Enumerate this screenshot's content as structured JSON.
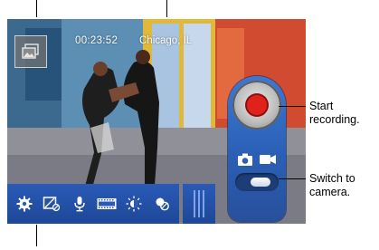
{
  "overlay": {
    "timer": "00:23:52",
    "location": "Chicago, IL"
  },
  "icons": {
    "thumbnail": "gallery-thumbnail-icon",
    "record": "record-icon",
    "camera": "camera-icon",
    "video": "video-camera-icon",
    "toolbar": [
      "settings-gear-icon",
      "flash-off-icon",
      "microphone-icon",
      "film-strip-icon",
      "brightness-icon",
      "effects-icon"
    ]
  },
  "callouts": {
    "record": "Start recording.",
    "switch": "Switch to camera."
  },
  "colors": {
    "panel_blue": "#2b5fb5",
    "record_red": "#e1211b"
  }
}
